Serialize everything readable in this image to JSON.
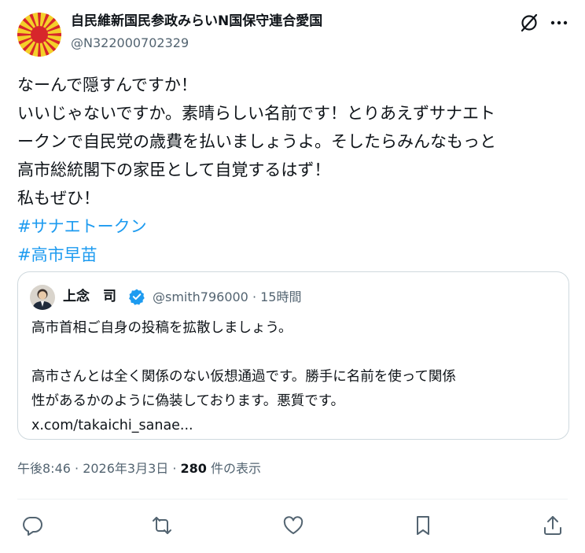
{
  "author": {
    "name": "自民維新国民参政みらいN国保守連合愛国",
    "handle": "@N322000702329"
  },
  "post": {
    "lines": [
      "なーんで隠すんですか！",
      "いいじゃないですか。素晴らしい名前です！とりあえずサナエト",
      "ークンで自民党の歳費を払いましょうよ。そしたらみんなもっと",
      "高市総統閣下の家臣として自覚するはず！",
      "私もぜひ！"
    ],
    "hashtags": [
      "#サナエトークン",
      "#高市早苗"
    ]
  },
  "quote": {
    "name": "上念　司",
    "handle_time": "@smith796000 · 15時間",
    "lines": [
      "高市首相ご自身の投稿を拡散しましょう。",
      "",
      "高市さんとは全く関係のない仮想通過です。勝手に名前を使って関係",
      "性があるかのように偽装しております。悪質です。"
    ],
    "link": "x.com/takaichi_sanae..."
  },
  "meta": {
    "time": "午後8:46 · 2026年3月3日 · ",
    "views": "280",
    "views_label": " 件の表示"
  },
  "colors": {
    "accent": "#1d9bf0",
    "secondary": "#536471",
    "border": "#cfd9de"
  },
  "icons": [
    "grok-icon",
    "more-icon",
    "verified-badge-icon",
    "reply-icon",
    "repost-icon",
    "like-icon",
    "bookmark-icon",
    "share-icon"
  ]
}
